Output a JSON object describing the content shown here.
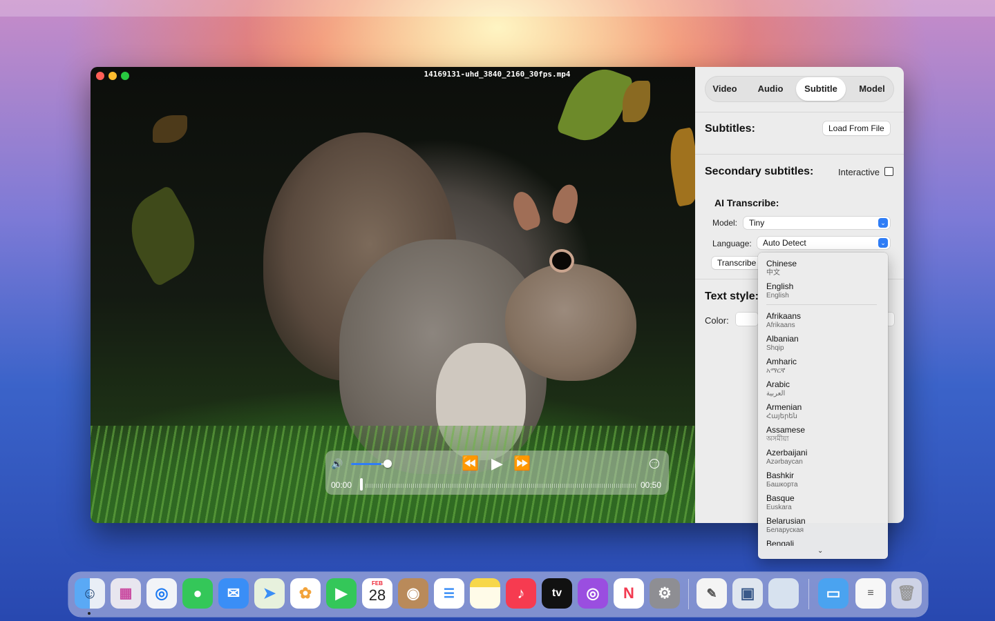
{
  "window": {
    "title": "14169131-uhd_3840_2160_30fps.mp4"
  },
  "player": {
    "time_current": "00:00",
    "time_total": "00:50",
    "volume_level": 0.8
  },
  "sidebar": {
    "tabs": [
      {
        "label": "Video",
        "active": false
      },
      {
        "label": "Audio",
        "active": false
      },
      {
        "label": "Subtitle",
        "active": true
      },
      {
        "label": "Model",
        "active": false
      }
    ],
    "subtitles_title": "Subtitles:",
    "load_from_file": "Load From File",
    "secondary_title": "Secondary subtitles:",
    "interactive_label": "Interactive",
    "ai_title": "AI Transcribe:",
    "model_label": "Model:",
    "model_value": "Tiny",
    "language_label": "Language:",
    "language_value": "Auto Detect",
    "transcribe_button": "Transcribe",
    "text_style_title": "Text style:",
    "color_label": "Color:"
  },
  "language_menu": {
    "items": [
      {
        "name": "Chinese",
        "native": "中文"
      },
      {
        "name": "English",
        "native": "English"
      },
      {
        "name": "Afrikaans",
        "native": "Afrikaans"
      },
      {
        "name": "Albanian",
        "native": "Shqip"
      },
      {
        "name": "Amharic",
        "native": "አማርኛ"
      },
      {
        "name": "Arabic",
        "native": "العربية"
      },
      {
        "name": "Armenian",
        "native": "Հայերեն"
      },
      {
        "name": "Assamese",
        "native": "অসমীয়া"
      },
      {
        "name": "Azerbaijani",
        "native": "Azərbaycan"
      },
      {
        "name": "Bashkir",
        "native": "Башкорта"
      },
      {
        "name": "Basque",
        "native": "Euskara"
      },
      {
        "name": "Belarusian",
        "native": "Беларуская"
      },
      {
        "name": "Bengali",
        "native": ""
      }
    ]
  },
  "dock": {
    "calendar_month": "FEB",
    "calendar_day": "28",
    "tv_label": "tv"
  }
}
